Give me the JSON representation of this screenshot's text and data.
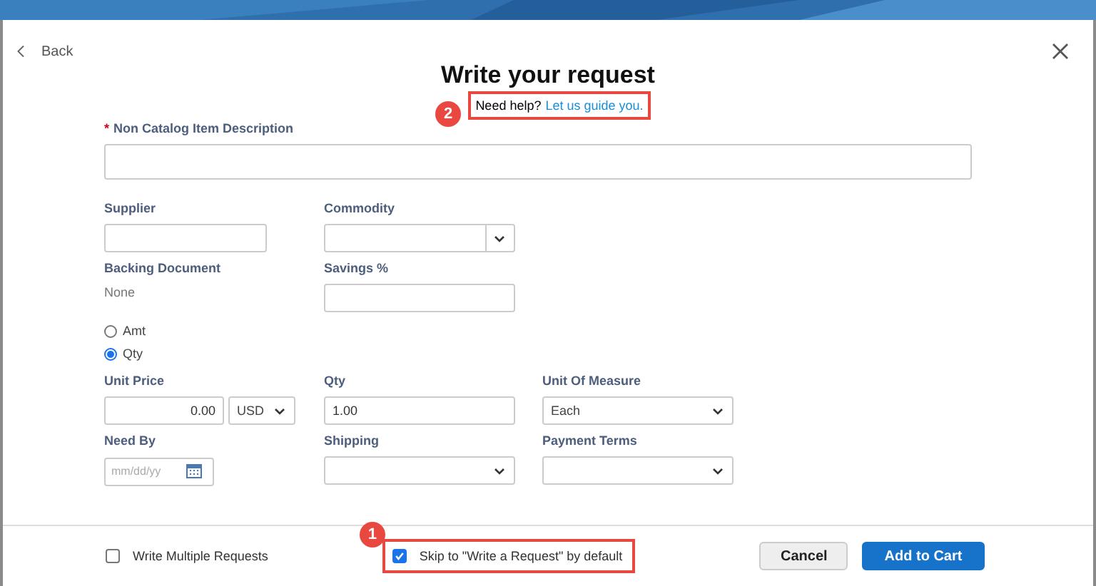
{
  "header": {
    "back": "Back",
    "title": "Write your request",
    "help_text": "Need help?",
    "help_link": "Let us guide you.",
    "help_callout": "2"
  },
  "description": {
    "label": "Non Catalog Item Description",
    "required_mark": "*"
  },
  "rows": [
    [
      {
        "kind": "text",
        "label": "Supplier"
      },
      {
        "kind": "select",
        "label": "Commodity",
        "boxed_caret": true
      }
    ],
    [
      {
        "kind": "static",
        "label": "Backing Document",
        "value": "None"
      },
      {
        "kind": "text",
        "label": "Savings %"
      }
    ],
    [
      {
        "kind": "radio",
        "options": [
          {
            "label": "Amt",
            "selected": false
          },
          {
            "label": "Qty",
            "selected": true
          }
        ]
      }
    ],
    [
      {
        "kind": "currency",
        "label": "Unit Price",
        "value": "0.00",
        "currency": "USD"
      },
      {
        "kind": "text",
        "label": "Qty",
        "value": "1.00"
      },
      {
        "kind": "select",
        "label": "Unit Of Measure",
        "value": "Each"
      }
    ],
    [
      {
        "kind": "date",
        "label": "Need By",
        "placeholder": "mm/dd/yy"
      },
      {
        "kind": "select",
        "label": "Shipping"
      },
      {
        "kind": "select",
        "label": "Payment Terms"
      }
    ]
  ],
  "footer": {
    "options": [
      {
        "label": "Write Multiple Requests",
        "checked": false
      },
      {
        "label": "Skip to \"Write a Request\" by default",
        "checked": true,
        "callout": "1"
      }
    ],
    "buttons": [
      {
        "label": "Cancel",
        "kind": "secondary"
      },
      {
        "label": "Add to Cart",
        "kind": "primary"
      }
    ]
  }
}
